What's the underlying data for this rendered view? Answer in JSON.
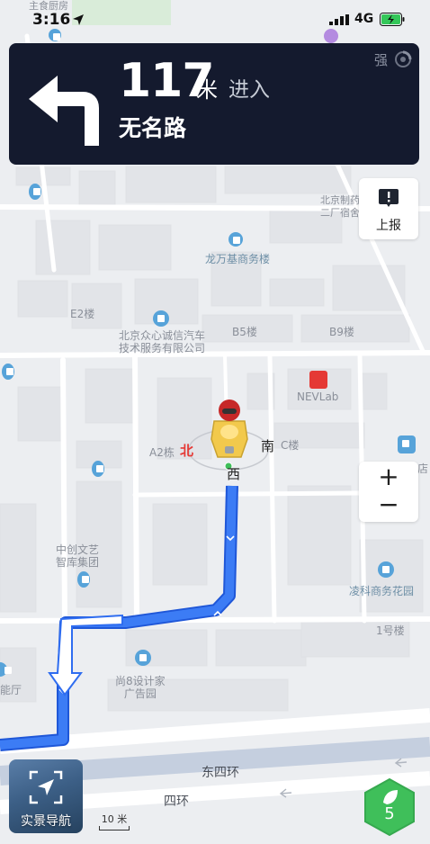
{
  "status_bar": {
    "time": "3:16",
    "network": "4G",
    "icons": [
      "location-arrow-icon",
      "signal-bars-icon",
      "battery-charging-icon"
    ]
  },
  "nav_card": {
    "distance_value": "117",
    "distance_unit": "米",
    "action": "进入",
    "road_name": "无名路",
    "gps_strength": "强",
    "turn_icon": "turn-left-arrow-icon"
  },
  "report": {
    "label": "上报",
    "icon": "exclamation-icon"
  },
  "zoom": {
    "in_label": "+",
    "out_label": "−"
  },
  "live_view": {
    "label": "实景导航",
    "icon": "compass-arrow-icon"
  },
  "scale": {
    "label": "10 米"
  },
  "green_badge": {
    "count": "5",
    "icon": "leaf-icon"
  },
  "compass": {
    "north": "北",
    "south": "南",
    "west": "西"
  },
  "map_labels": {
    "top_left_poi": "主食厨房",
    "bjzz": "北京制药\n二厂宿舍",
    "longwanji": "龙万基商务楼",
    "e2": "E2楼",
    "zhongxin": "北京众心诚信汽车\n技术服务有限公司",
    "b5": "B5楼",
    "b9": "B9楼",
    "nevlab": "NEVLab",
    "a2": "A2栋",
    "c_building": "C楼",
    "zhongchuang": "中创文艺\n智库集团",
    "lingke": "凌科商务花园",
    "hall_fragment": "能厅",
    "shang8": "尚8设计家\n广告园",
    "building1": "1号楼",
    "dongsihuan": "东四环",
    "sihuan": "四环",
    "right_fragment": "店",
    "top_right_fragment": "北京"
  },
  "colors": {
    "nav_card_bg": "#141a2e",
    "route_blue": "#2f6df0",
    "green_badge": "#3fbf5a",
    "map_bg": "#eceef1",
    "poi_blue": "#57a3d9"
  }
}
